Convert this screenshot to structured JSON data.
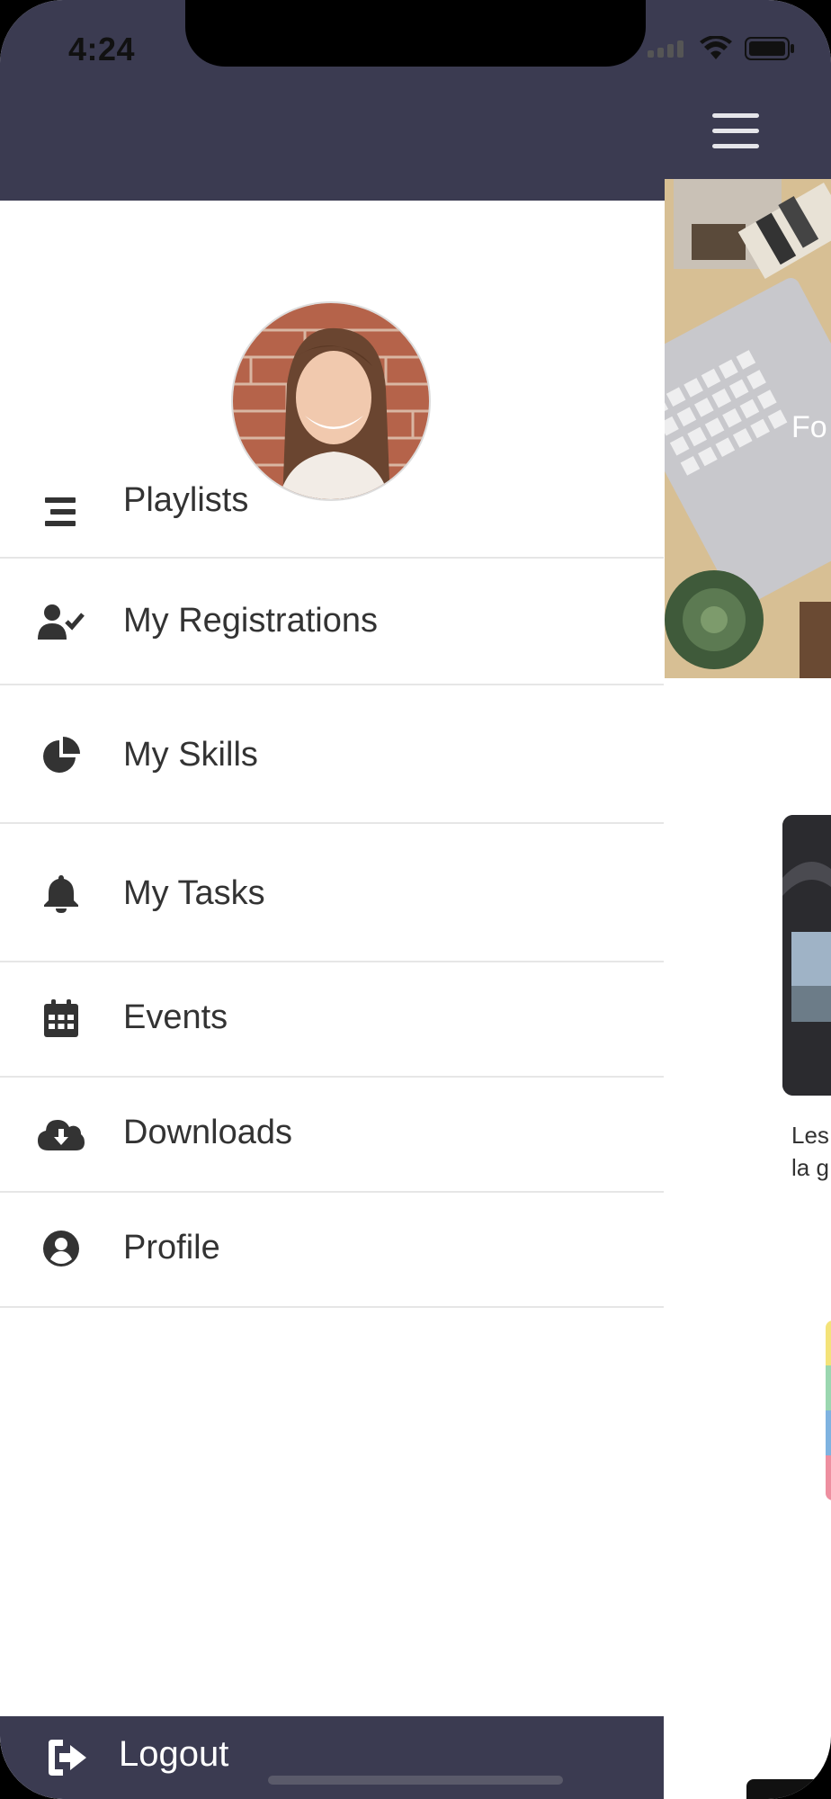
{
  "status_bar": {
    "time": "4:24"
  },
  "header": {
    "menu_button": "hamburger-icon"
  },
  "drawer": {
    "menu": [
      {
        "label": "Playlists",
        "icon": "list-icon"
      },
      {
        "label": "My Registrations",
        "icon": "user-check-icon"
      },
      {
        "label": "My Skills",
        "icon": "pie-chart-icon"
      },
      {
        "label": "My Tasks",
        "icon": "bell-icon"
      },
      {
        "label": "Events",
        "icon": "calendar-icon"
      },
      {
        "label": "Downloads",
        "icon": "cloud-download-icon"
      },
      {
        "label": "Profile",
        "icon": "user-circle-icon"
      }
    ],
    "logout": {
      "label": "Logout",
      "icon": "sign-out-icon"
    }
  },
  "background_content": {
    "hero_text": "Fo",
    "card_text_line1": "Les",
    "card_text_line2": "la g"
  },
  "colors": {
    "header": "#3b3b51",
    "text": "#333333",
    "divider": "#e6e6e6"
  }
}
